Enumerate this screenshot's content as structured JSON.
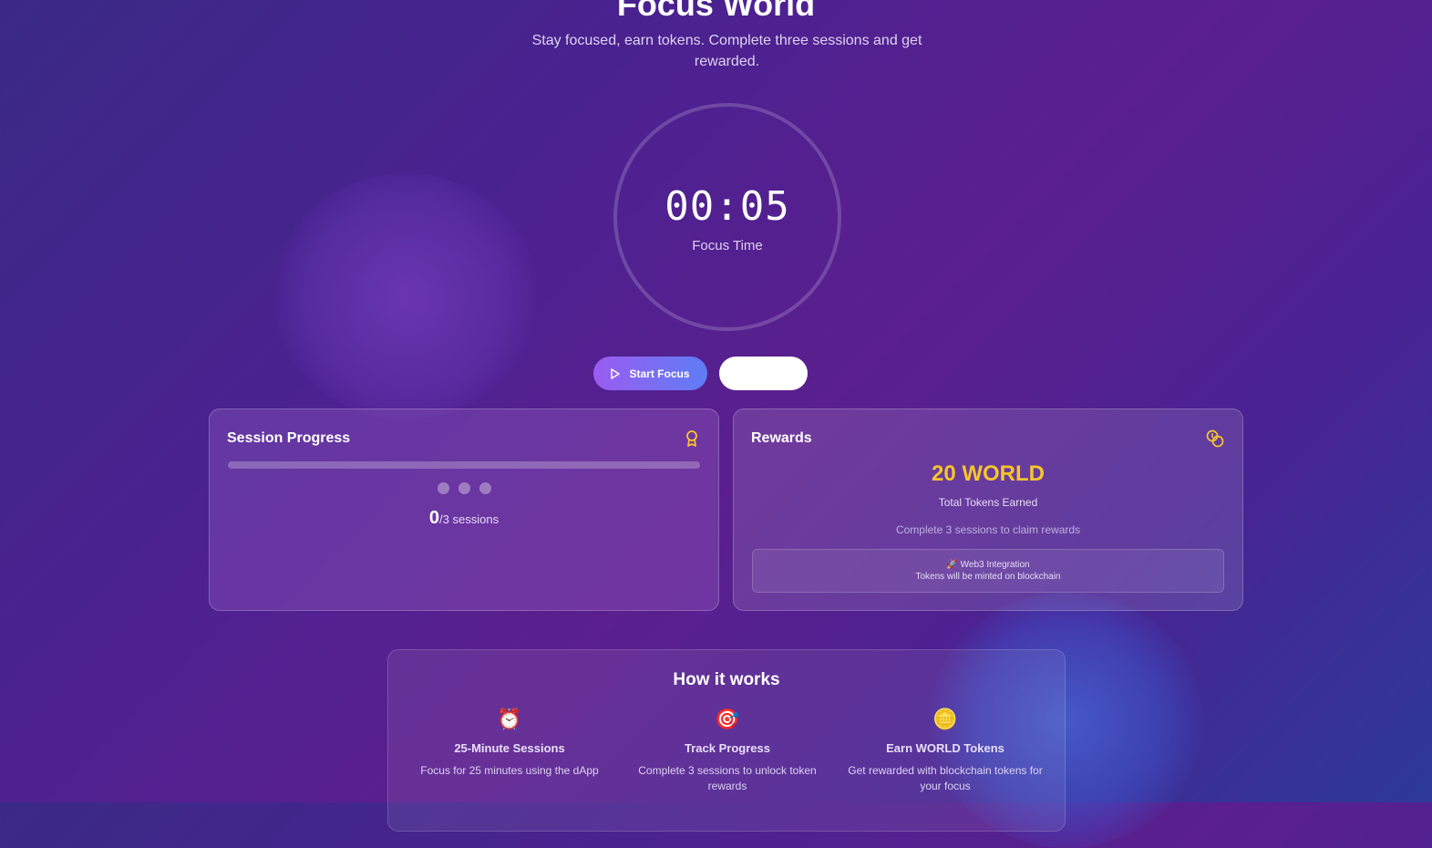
{
  "header": {
    "title": "Focus World",
    "subtitle": "Stay focused, earn tokens. Complete three sessions and get rewarded."
  },
  "timer": {
    "value": "00:05",
    "label": "Focus Time"
  },
  "controls": {
    "start_label": "Start Focus",
    "play_icon": "play-icon"
  },
  "session_progress": {
    "title": "Session Progress",
    "icon": "award-icon",
    "completed": "0",
    "total_text": "/3 sessions",
    "progress_fraction": 0
  },
  "rewards": {
    "title": "Rewards",
    "icon": "coins-icon",
    "amount": "20 WORLD",
    "amount_label": "Total Tokens Earned",
    "hint": "Complete 3 sessions to claim rewards",
    "web3_title": "🚀 Web3 Integration",
    "web3_desc": "Tokens will be minted on blockchain"
  },
  "how_it_works": {
    "title": "How it works",
    "steps": [
      {
        "icon": "⏰",
        "title": "25-Minute Sessions",
        "desc": "Focus for 25 minutes using the dApp"
      },
      {
        "icon": "🎯",
        "title": "Track Progress",
        "desc": "Complete 3 sessions to unlock token rewards"
      },
      {
        "icon": "🪙",
        "title": "Earn WORLD Tokens",
        "desc": "Get rewarded with blockchain tokens for your focus"
      }
    ]
  },
  "colors": {
    "accent_gold": "#f7c52a",
    "button_gradient_start": "#9a5cf0",
    "button_gradient_end": "#5f7df5"
  }
}
